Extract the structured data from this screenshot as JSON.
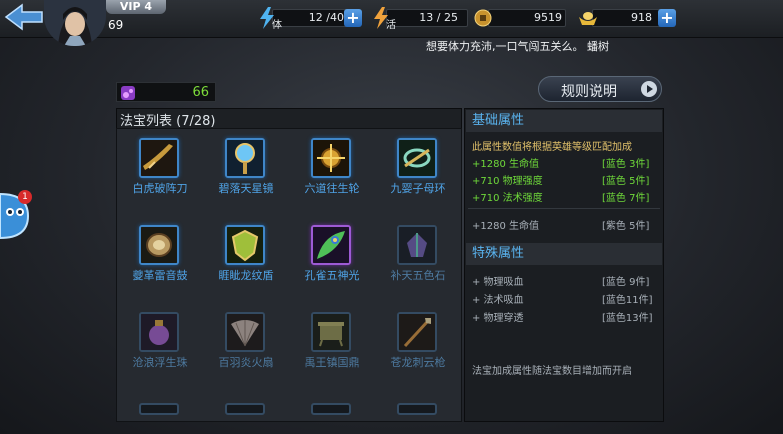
{
  "header": {
    "vip_label": "VIP 4",
    "level": "69",
    "stamina_label": "体",
    "stamina_value": "12 /40",
    "energy_label": "活",
    "energy_value": "13 / 25",
    "coins": "9519",
    "gold": "918",
    "ticker_text": "想要体力充沛,一口气闯五关么。 蟠树"
  },
  "gem": {
    "count": "66"
  },
  "rules_button": {
    "label": "规则说明"
  },
  "treasure_list": {
    "title": "法宝列表 (7/28)",
    "items": [
      {
        "name": "白虎破阵刀"
      },
      {
        "name": "碧落天星镜"
      },
      {
        "name": "六道往生轮"
      },
      {
        "name": "九婴子母环"
      },
      {
        "name": "夔革雷音鼓"
      },
      {
        "name": "睚眦龙纹盾"
      },
      {
        "name": "孔雀五神光"
      },
      {
        "name": "补天五色石"
      },
      {
        "name": "沧浪浮生珠"
      },
      {
        "name": "百羽炎火扇"
      },
      {
        "name": "禹王镇国鼎"
      },
      {
        "name": "苍龙刺云枪"
      }
    ]
  },
  "base_attributes": {
    "title": "基础属性",
    "note": "此属性数值将根据英雄等级匹配加成",
    "rows": [
      {
        "value": "+1280 生命值",
        "req": "[蓝色 3件]"
      },
      {
        "value": "+710 物理强度",
        "req": "[蓝色 5件]"
      },
      {
        "value": "+710 法术强度",
        "req": "[蓝色 7件]"
      }
    ],
    "extra": {
      "value": "+1280 生命值",
      "req": "[紫色 5件]"
    }
  },
  "special_attributes": {
    "title": "特殊属性",
    "rows": [
      {
        "value": "+ 物理吸血",
        "req": "[蓝色 9件]"
      },
      {
        "value": "+ 法术吸血",
        "req": "[蓝色11件]"
      },
      {
        "value": "+ 物理穿透",
        "req": "[蓝色13件]"
      }
    ],
    "footer": "法宝加成属性随法宝数目增加而开启"
  },
  "mascot": {
    "badge": "1"
  },
  "colors": {
    "accent_blue": "#4fa3e6",
    "attr_green": "#6fd93a",
    "gem_green": "#7ddc3a",
    "header_blue": "#5ab4f0"
  }
}
